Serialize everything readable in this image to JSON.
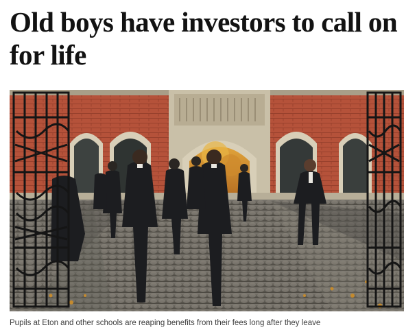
{
  "article": {
    "headline": "Old boys have investors to call on for life",
    "image_alt": "Pupils in tailcoats walking through a gateway into a school courtyard",
    "caption": "Pupils at Eton and other schools are reaping benefits from their fees long after they leave"
  }
}
